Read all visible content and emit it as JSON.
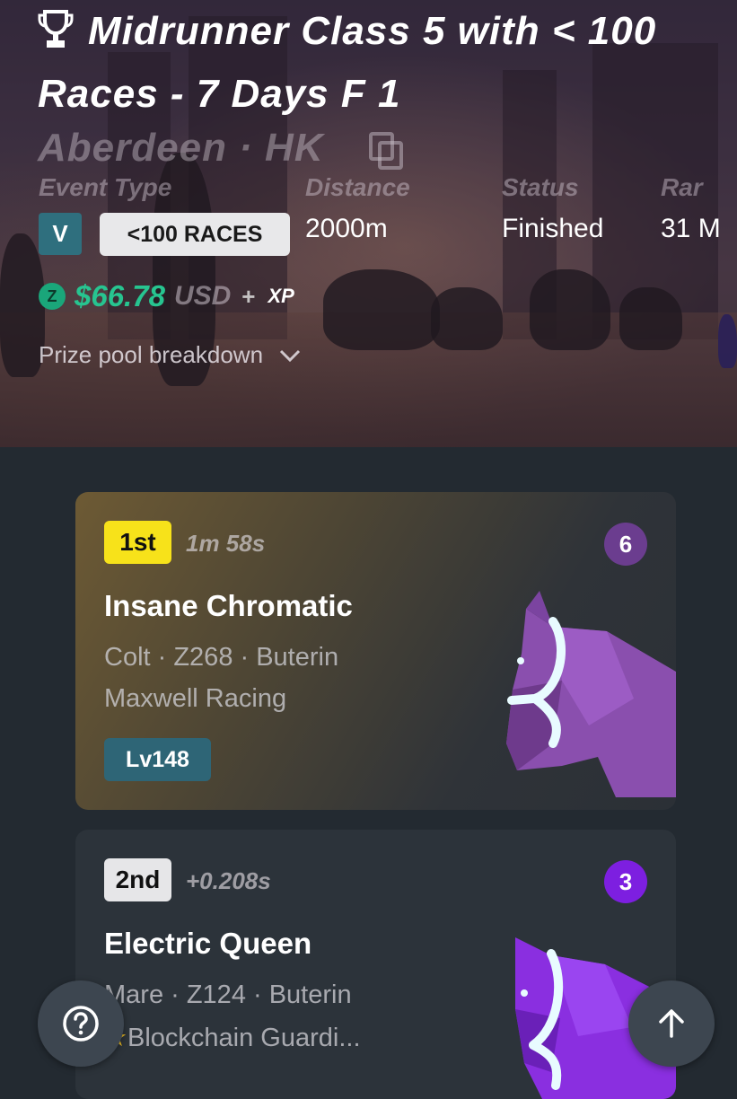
{
  "event": {
    "title": "Midrunner Class 5 with < 100 Races - 7 Days F 1",
    "location": "Aberdeen · HK",
    "labels": {
      "event_type": "Event Type",
      "distance": "Distance",
      "status": "Status",
      "races": "Rar"
    },
    "event_type_badge": "V",
    "races_badge": "<100 RACES",
    "distance": "2000m",
    "status": "Finished",
    "races_value": "31 M",
    "prize": {
      "amount": "$66.78",
      "currency": "USD",
      "plus": "+",
      "xp": "XP"
    },
    "breakdown_label": "Prize pool breakdown"
  },
  "results": [
    {
      "position": "1st",
      "time": "1m 58s",
      "gate": "6",
      "name": "Insane Chromatic",
      "info": "Colt · Z268 · Buterin",
      "stable": "Maxwell Racing",
      "level": "Lv148"
    },
    {
      "position": "2nd",
      "time": "+0.208s",
      "gate": "3",
      "name": "Electric Queen",
      "info": "Mare · Z124 · Buterin",
      "stable": "Blockchain Guardi..."
    }
  ],
  "colors": {
    "accent_green": "#27c490",
    "first_badge": "#f7e21a",
    "gate_purple_1": "#6b3d8f",
    "gate_purple_2": "#7d1fe0",
    "level_badge": "#2e6576"
  },
  "icons": [
    "trophy-icon",
    "copy-icon",
    "zed-icon",
    "chevron-down-icon",
    "help-icon",
    "arrow-up-icon"
  ]
}
